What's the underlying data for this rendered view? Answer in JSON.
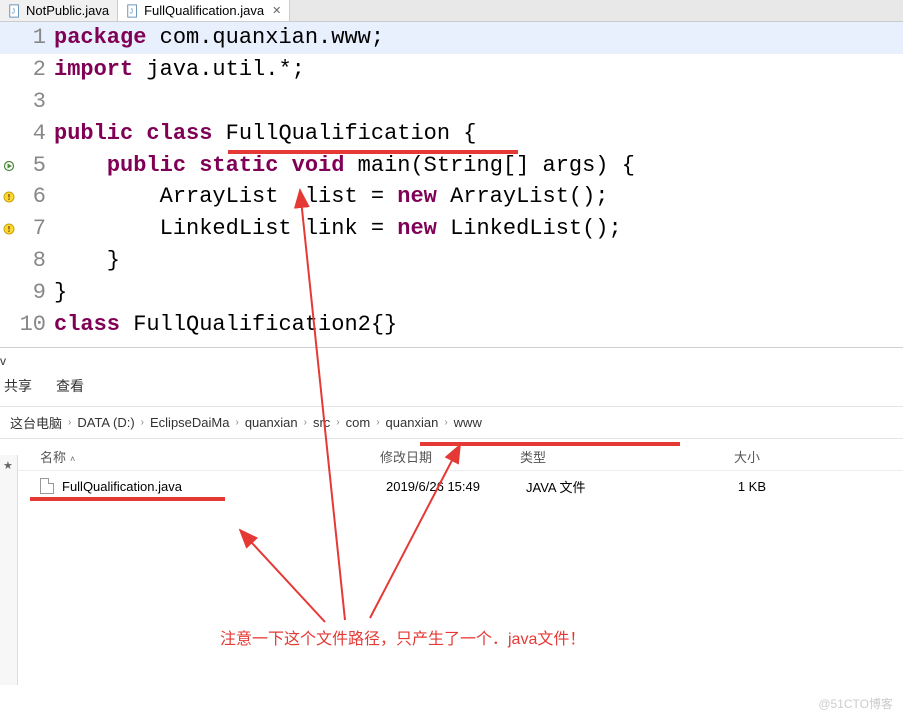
{
  "tabs": [
    {
      "label": "NotPublic.java",
      "active": false
    },
    {
      "label": "FullQualification.java",
      "active": true
    }
  ],
  "code": {
    "lines": [
      {
        "n": 1,
        "segs": [
          [
            "kw",
            "package"
          ],
          [
            "plain",
            " com.quanxian.www;"
          ]
        ]
      },
      {
        "n": 2,
        "segs": [
          [
            "kw",
            "import"
          ],
          [
            "plain",
            " java.util.*;"
          ]
        ]
      },
      {
        "n": 3,
        "segs": [
          [
            "plain",
            ""
          ]
        ]
      },
      {
        "n": 4,
        "segs": [
          [
            "kw",
            "public"
          ],
          [
            "plain",
            " "
          ],
          [
            "kw",
            "class"
          ],
          [
            "plain",
            " FullQualification {"
          ]
        ]
      },
      {
        "n": 5,
        "segs": [
          [
            "plain",
            "    "
          ],
          [
            "kw",
            "public"
          ],
          [
            "plain",
            " "
          ],
          [
            "kw",
            "static"
          ],
          [
            "plain",
            " "
          ],
          [
            "kw",
            "void"
          ],
          [
            "plain",
            " main(String[] args) {"
          ]
        ],
        "marker": "entry"
      },
      {
        "n": 6,
        "segs": [
          [
            "plain",
            "        ArrayList  list = "
          ],
          [
            "kw",
            "new"
          ],
          [
            "plain",
            " ArrayList();"
          ]
        ],
        "marker": "warn"
      },
      {
        "n": 7,
        "segs": [
          [
            "plain",
            "        LinkedList link = "
          ],
          [
            "kw",
            "new"
          ],
          [
            "plain",
            " LinkedList();"
          ]
        ],
        "marker": "warn"
      },
      {
        "n": 8,
        "segs": [
          [
            "plain",
            "    }"
          ]
        ]
      },
      {
        "n": 9,
        "segs": [
          [
            "plain",
            "}"
          ]
        ]
      },
      {
        "n": 10,
        "segs": [
          [
            "kw",
            "class"
          ],
          [
            "plain",
            " FullQualification2{}"
          ]
        ]
      }
    ]
  },
  "explorer": {
    "title_char": "v",
    "toolbar": {
      "share": "共享",
      "view": "查看"
    },
    "breadcrumb": [
      "这台电脑",
      "DATA (D:)",
      "EclipseDaiMa",
      "quanxian",
      "src",
      "com",
      "quanxian",
      "www"
    ],
    "columns": {
      "name": "名称",
      "date": "修改日期",
      "type": "类型",
      "size": "大小"
    },
    "files": [
      {
        "name": "FullQualification.java",
        "date": "2019/6/26 15:49",
        "type": "JAVA 文件",
        "size": "1 KB"
      }
    ]
  },
  "annotation": {
    "text": "注意一下这个文件路径，只产生了一个．java文件！"
  },
  "watermark": "@51CTO博客"
}
